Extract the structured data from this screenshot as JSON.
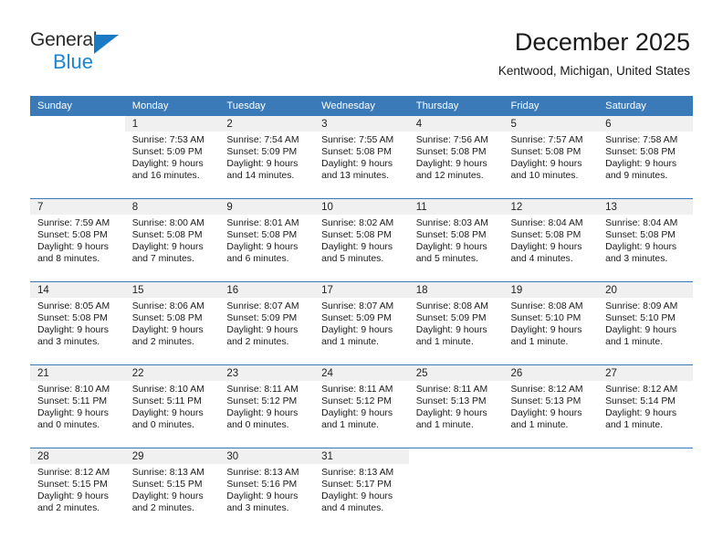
{
  "brand": {
    "name_part1": "General",
    "name_part2": "Blue",
    "accent_color": "#1a85d6",
    "triangle_color": "#1a7bc4"
  },
  "header": {
    "title": "December 2025",
    "subtitle": "Kentwood, Michigan, United States",
    "header_bg_color": "#3a7ab8"
  },
  "weekdays": [
    "Sunday",
    "Monday",
    "Tuesday",
    "Wednesday",
    "Thursday",
    "Friday",
    "Saturday"
  ],
  "weeks": [
    [
      {
        "day": "",
        "sunrise": "",
        "sunset": "",
        "daylight1": "",
        "daylight2": "",
        "empty": true
      },
      {
        "day": "1",
        "sunrise": "Sunrise: 7:53 AM",
        "sunset": "Sunset: 5:09 PM",
        "daylight1": "Daylight: 9 hours",
        "daylight2": "and 16 minutes."
      },
      {
        "day": "2",
        "sunrise": "Sunrise: 7:54 AM",
        "sunset": "Sunset: 5:09 PM",
        "daylight1": "Daylight: 9 hours",
        "daylight2": "and 14 minutes."
      },
      {
        "day": "3",
        "sunrise": "Sunrise: 7:55 AM",
        "sunset": "Sunset: 5:08 PM",
        "daylight1": "Daylight: 9 hours",
        "daylight2": "and 13 minutes."
      },
      {
        "day": "4",
        "sunrise": "Sunrise: 7:56 AM",
        "sunset": "Sunset: 5:08 PM",
        "daylight1": "Daylight: 9 hours",
        "daylight2": "and 12 minutes."
      },
      {
        "day": "5",
        "sunrise": "Sunrise: 7:57 AM",
        "sunset": "Sunset: 5:08 PM",
        "daylight1": "Daylight: 9 hours",
        "daylight2": "and 10 minutes."
      },
      {
        "day": "6",
        "sunrise": "Sunrise: 7:58 AM",
        "sunset": "Sunset: 5:08 PM",
        "daylight1": "Daylight: 9 hours",
        "daylight2": "and 9 minutes."
      }
    ],
    [
      {
        "day": "7",
        "sunrise": "Sunrise: 7:59 AM",
        "sunset": "Sunset: 5:08 PM",
        "daylight1": "Daylight: 9 hours",
        "daylight2": "and 8 minutes."
      },
      {
        "day": "8",
        "sunrise": "Sunrise: 8:00 AM",
        "sunset": "Sunset: 5:08 PM",
        "daylight1": "Daylight: 9 hours",
        "daylight2": "and 7 minutes."
      },
      {
        "day": "9",
        "sunrise": "Sunrise: 8:01 AM",
        "sunset": "Sunset: 5:08 PM",
        "daylight1": "Daylight: 9 hours",
        "daylight2": "and 6 minutes."
      },
      {
        "day": "10",
        "sunrise": "Sunrise: 8:02 AM",
        "sunset": "Sunset: 5:08 PM",
        "daylight1": "Daylight: 9 hours",
        "daylight2": "and 5 minutes."
      },
      {
        "day": "11",
        "sunrise": "Sunrise: 8:03 AM",
        "sunset": "Sunset: 5:08 PM",
        "daylight1": "Daylight: 9 hours",
        "daylight2": "and 5 minutes."
      },
      {
        "day": "12",
        "sunrise": "Sunrise: 8:04 AM",
        "sunset": "Sunset: 5:08 PM",
        "daylight1": "Daylight: 9 hours",
        "daylight2": "and 4 minutes."
      },
      {
        "day": "13",
        "sunrise": "Sunrise: 8:04 AM",
        "sunset": "Sunset: 5:08 PM",
        "daylight1": "Daylight: 9 hours",
        "daylight2": "and 3 minutes."
      }
    ],
    [
      {
        "day": "14",
        "sunrise": "Sunrise: 8:05 AM",
        "sunset": "Sunset: 5:08 PM",
        "daylight1": "Daylight: 9 hours",
        "daylight2": "and 3 minutes."
      },
      {
        "day": "15",
        "sunrise": "Sunrise: 8:06 AM",
        "sunset": "Sunset: 5:08 PM",
        "daylight1": "Daylight: 9 hours",
        "daylight2": "and 2 minutes."
      },
      {
        "day": "16",
        "sunrise": "Sunrise: 8:07 AM",
        "sunset": "Sunset: 5:09 PM",
        "daylight1": "Daylight: 9 hours",
        "daylight2": "and 2 minutes."
      },
      {
        "day": "17",
        "sunrise": "Sunrise: 8:07 AM",
        "sunset": "Sunset: 5:09 PM",
        "daylight1": "Daylight: 9 hours",
        "daylight2": "and 1 minute."
      },
      {
        "day": "18",
        "sunrise": "Sunrise: 8:08 AM",
        "sunset": "Sunset: 5:09 PM",
        "daylight1": "Daylight: 9 hours",
        "daylight2": "and 1 minute."
      },
      {
        "day": "19",
        "sunrise": "Sunrise: 8:08 AM",
        "sunset": "Sunset: 5:10 PM",
        "daylight1": "Daylight: 9 hours",
        "daylight2": "and 1 minute."
      },
      {
        "day": "20",
        "sunrise": "Sunrise: 8:09 AM",
        "sunset": "Sunset: 5:10 PM",
        "daylight1": "Daylight: 9 hours",
        "daylight2": "and 1 minute."
      }
    ],
    [
      {
        "day": "21",
        "sunrise": "Sunrise: 8:10 AM",
        "sunset": "Sunset: 5:11 PM",
        "daylight1": "Daylight: 9 hours",
        "daylight2": "and 0 minutes."
      },
      {
        "day": "22",
        "sunrise": "Sunrise: 8:10 AM",
        "sunset": "Sunset: 5:11 PM",
        "daylight1": "Daylight: 9 hours",
        "daylight2": "and 0 minutes."
      },
      {
        "day": "23",
        "sunrise": "Sunrise: 8:11 AM",
        "sunset": "Sunset: 5:12 PM",
        "daylight1": "Daylight: 9 hours",
        "daylight2": "and 0 minutes."
      },
      {
        "day": "24",
        "sunrise": "Sunrise: 8:11 AM",
        "sunset": "Sunset: 5:12 PM",
        "daylight1": "Daylight: 9 hours",
        "daylight2": "and 1 minute."
      },
      {
        "day": "25",
        "sunrise": "Sunrise: 8:11 AM",
        "sunset": "Sunset: 5:13 PM",
        "daylight1": "Daylight: 9 hours",
        "daylight2": "and 1 minute."
      },
      {
        "day": "26",
        "sunrise": "Sunrise: 8:12 AM",
        "sunset": "Sunset: 5:13 PM",
        "daylight1": "Daylight: 9 hours",
        "daylight2": "and 1 minute."
      },
      {
        "day": "27",
        "sunrise": "Sunrise: 8:12 AM",
        "sunset": "Sunset: 5:14 PM",
        "daylight1": "Daylight: 9 hours",
        "daylight2": "and 1 minute."
      }
    ],
    [
      {
        "day": "28",
        "sunrise": "Sunrise: 8:12 AM",
        "sunset": "Sunset: 5:15 PM",
        "daylight1": "Daylight: 9 hours",
        "daylight2": "and 2 minutes."
      },
      {
        "day": "29",
        "sunrise": "Sunrise: 8:13 AM",
        "sunset": "Sunset: 5:15 PM",
        "daylight1": "Daylight: 9 hours",
        "daylight2": "and 2 minutes."
      },
      {
        "day": "30",
        "sunrise": "Sunrise: 8:13 AM",
        "sunset": "Sunset: 5:16 PM",
        "daylight1": "Daylight: 9 hours",
        "daylight2": "and 3 minutes."
      },
      {
        "day": "31",
        "sunrise": "Sunrise: 8:13 AM",
        "sunset": "Sunset: 5:17 PM",
        "daylight1": "Daylight: 9 hours",
        "daylight2": "and 4 minutes."
      },
      {
        "day": "",
        "sunrise": "",
        "sunset": "",
        "daylight1": "",
        "daylight2": "",
        "empty": true
      },
      {
        "day": "",
        "sunrise": "",
        "sunset": "",
        "daylight1": "",
        "daylight2": "",
        "empty": true
      },
      {
        "day": "",
        "sunrise": "",
        "sunset": "",
        "daylight1": "",
        "daylight2": "",
        "empty": true
      }
    ]
  ]
}
